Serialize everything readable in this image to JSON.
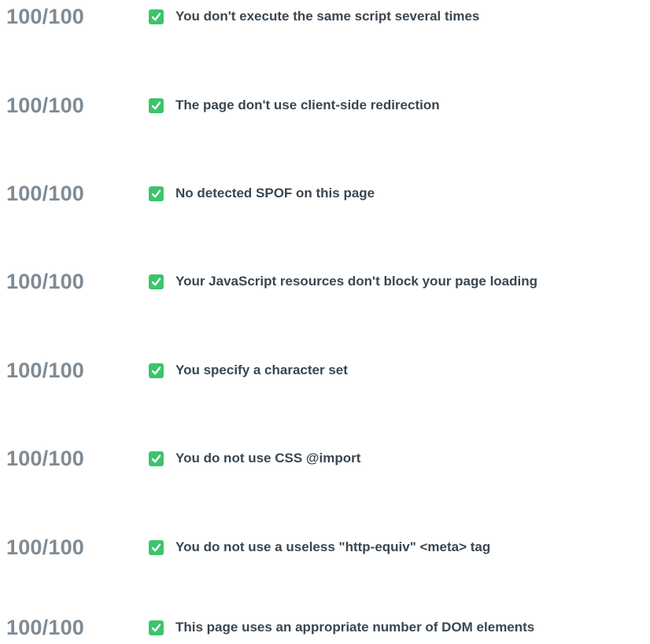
{
  "checks": [
    {
      "score": "100/100",
      "label": "You don't execute the same script several times",
      "status_icon": "check-icon"
    },
    {
      "score": "100/100",
      "label": "The page don't use client-side redirection",
      "status_icon": "check-icon"
    },
    {
      "score": "100/100",
      "label": "No detected SPOF on this page",
      "status_icon": "check-icon"
    },
    {
      "score": "100/100",
      "label": "Your JavaScript resources don't block your page loading",
      "status_icon": "check-icon"
    },
    {
      "score": "100/100",
      "label": "You specify a character set",
      "status_icon": "check-icon"
    },
    {
      "score": "100/100",
      "label": "You do not use CSS @import",
      "status_icon": "check-icon"
    },
    {
      "score": "100/100",
      "label": "You do not use a useless \"http-equiv\" <meta> tag",
      "status_icon": "check-icon"
    },
    {
      "score": "100/100",
      "label": "This page uses an appropriate number of DOM elements",
      "status_icon": "check-icon"
    }
  ],
  "colors": {
    "score_text": "#7f8b95",
    "label_text": "#3a4650",
    "check_green": "#3cc46b"
  }
}
